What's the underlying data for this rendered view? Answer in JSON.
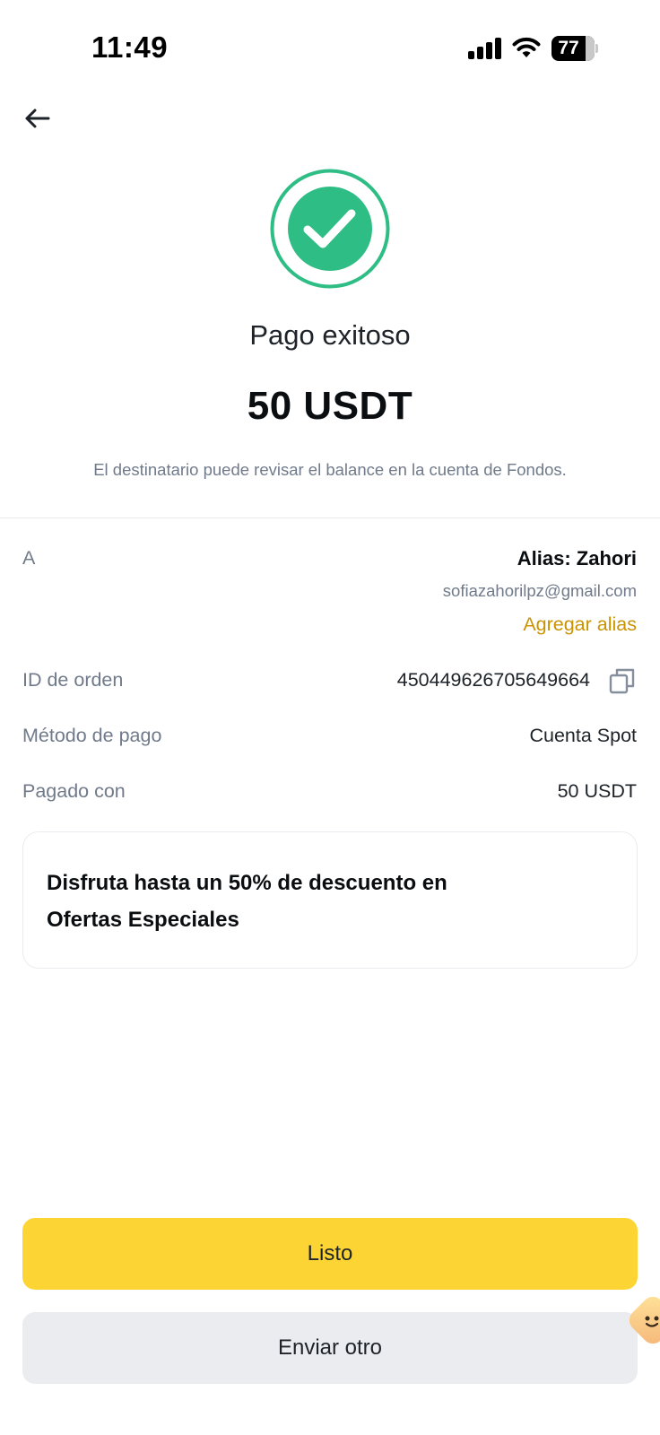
{
  "status_bar": {
    "time": "11:49",
    "battery": "77",
    "icons": [
      "signal-icon",
      "wifi-icon",
      "battery-icon"
    ]
  },
  "header": {
    "back_icon": "arrow-left-icon"
  },
  "result": {
    "icon": "check-circle-icon",
    "title": "Pago exitoso",
    "amount": "50 USDT",
    "subtitle": "El destinatario puede revisar el balance en la cuenta de Fondos."
  },
  "details": {
    "recipient_label": "A",
    "recipient_alias": "Alias: Zahori",
    "recipient_email": "sofiazahorilpz@gmail.com",
    "add_alias_label": "Agregar alias",
    "order_id_label": "ID de orden",
    "order_id_value": "450449626705649664",
    "payment_method_label": "Método de pago",
    "payment_method_value": "Cuenta Spot",
    "paid_with_label": "Pagado con",
    "paid_with_value": "50 USDT"
  },
  "promo": {
    "text": "Disfruta hasta un 50% de descuento en Ofertas Especiales"
  },
  "actions": {
    "done_label": "Listo",
    "send_another_label": "Enviar otro"
  },
  "colors": {
    "success_green": "#2ebd85",
    "accent_yellow": "#fcd535",
    "link_gold": "#c99400",
    "secondary_gray": "#eaecef"
  }
}
